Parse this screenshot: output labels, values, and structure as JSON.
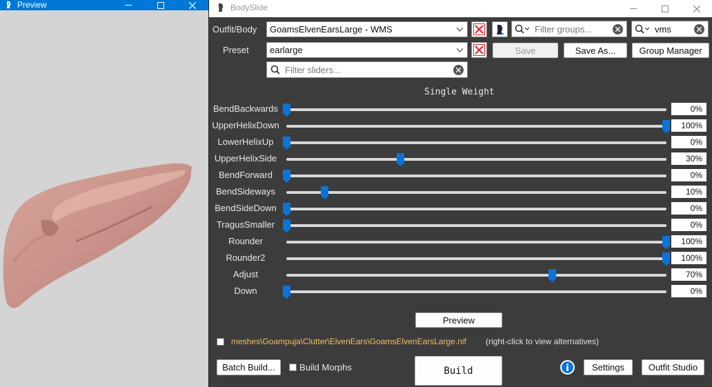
{
  "preview_window": {
    "title": "Preview",
    "icon": "preview-app-icon"
  },
  "bodyslide_window": {
    "title": "BodySlide",
    "icon": "bodyslide-app-icon"
  },
  "outfit": {
    "label": "Outfit/Body",
    "selected": "GoamsElvenEarsLarge - WMS",
    "groups_filter_placeholder": "Filter groups...",
    "outfit_filter_value": "vms"
  },
  "preset": {
    "label": "Preset",
    "selected": "earlarge",
    "save_label": "Save",
    "save_as_label": "Save As...",
    "group_manager_label": "Group Manager"
  },
  "slider_filter_placeholder": "Filter sliders...",
  "weight_header": "Single Weight",
  "sliders": [
    {
      "name": "BendBackwards",
      "value": 0,
      "display": "0%"
    },
    {
      "name": "UpperHelixDown",
      "value": 100,
      "display": "100%"
    },
    {
      "name": "LowerHelixUp",
      "value": 0,
      "display": "0%"
    },
    {
      "name": "UpperHelixSide",
      "value": 30,
      "display": "30%"
    },
    {
      "name": "BendForward",
      "value": 0,
      "display": "0%"
    },
    {
      "name": "BendSideways",
      "value": 10,
      "display": "10%"
    },
    {
      "name": "BendSideDown",
      "value": 0,
      "display": "0%"
    },
    {
      "name": "TragusSmaller",
      "value": 0,
      "display": "0%"
    },
    {
      "name": "Rounder",
      "value": 100,
      "display": "100%"
    },
    {
      "name": "Rounder2",
      "value": 100,
      "display": "100%"
    },
    {
      "name": "Adjust",
      "value": 70,
      "display": "70%"
    },
    {
      "name": "Down",
      "value": 0,
      "display": "0%"
    }
  ],
  "preview_button_label": "Preview",
  "outfit_file": {
    "path": "meshes\\Goampuja\\Clutter\\ElvenEars\\GoamsElvenEarsLarge.nif",
    "hint": "(right-click to view alternatives)"
  },
  "bottom": {
    "batch_build_label": "Batch Build...",
    "build_morphs_label": "Build Morphs",
    "build_label": "Build",
    "settings_label": "Settings",
    "outfit_studio_label": "Outfit Studio"
  },
  "colors": {
    "titlebar_active": "#0078d7",
    "panel_bg": "#3c3c3c",
    "slider_thumb": "#0a74d8",
    "path_text": "#f0c060",
    "skin": "#c9968a"
  }
}
